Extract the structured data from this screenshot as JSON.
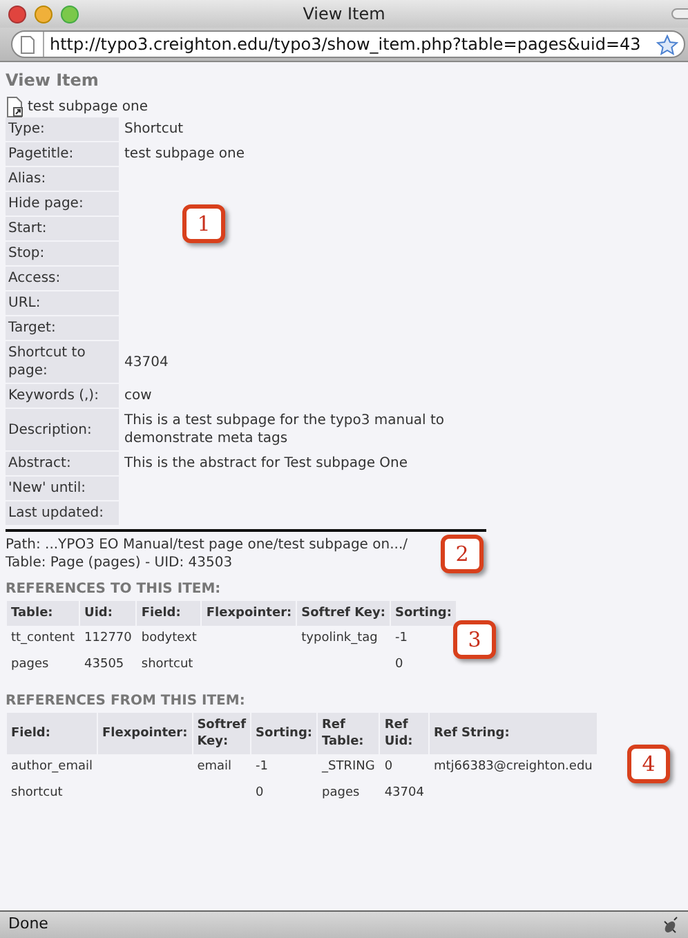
{
  "window": {
    "title": "View Item"
  },
  "address_bar": {
    "url": "http://typo3.creighton.edu/typo3/show_item.php?table=pages&uid=43"
  },
  "page": {
    "heading": "View Item",
    "record_title": "test subpage one",
    "fields": [
      {
        "label": "Type:",
        "value": "Shortcut"
      },
      {
        "label": "Pagetitle:",
        "value": "test subpage one"
      },
      {
        "label": "Alias:"
      },
      {
        "label": "Hide page:"
      },
      {
        "label": "Start:"
      },
      {
        "label": "Stop:"
      },
      {
        "label": "Access:"
      },
      {
        "label": "URL:"
      },
      {
        "label": "Target:"
      },
      {
        "label": "Shortcut to page:",
        "value": "43704"
      },
      {
        "label": "Keywords (,):",
        "value": "cow"
      },
      {
        "label": "Description:",
        "value": "This is a test subpage for the typo3 manual to demonstrate meta tags"
      },
      {
        "label": "Abstract:",
        "value": "This is the abstract for Test subpage One"
      },
      {
        "label": "'New' until:"
      },
      {
        "label": "Last updated:"
      }
    ],
    "path": "Path: ...YPO3 EO Manual/test page one/test subpage on.../",
    "table_info": "Table: Page (pages) - UID: 43503",
    "references_to": {
      "heading": "REFERENCES TO THIS ITEM:",
      "columns": [
        "Table:",
        "Uid:",
        "Field:",
        "Flexpointer:",
        "Softref Key:",
        "Sorting:"
      ],
      "rows": [
        [
          "tt_content",
          "112770",
          "bodytext",
          "",
          "typolink_tag",
          "-1"
        ],
        [
          "pages",
          "43505",
          "shortcut",
          "",
          "",
          "0"
        ]
      ]
    },
    "references_from": {
      "heading": "REFERENCES FROM THIS ITEM:",
      "columns": [
        "Field:",
        "Flexpointer:",
        "Softref Key:",
        "Sorting:",
        "Ref Table:",
        "Ref Uid:",
        "Ref String:"
      ],
      "rows": [
        [
          "author_email",
          "",
          "email",
          "-1",
          "_STRING",
          "0",
          "mtj66383@creighton.edu"
        ],
        [
          "shortcut",
          "",
          "",
          "0",
          "pages",
          "43704",
          ""
        ]
      ]
    }
  },
  "callouts": [
    "1",
    "2",
    "3",
    "4"
  ],
  "status_bar": {
    "text": "Done"
  }
}
